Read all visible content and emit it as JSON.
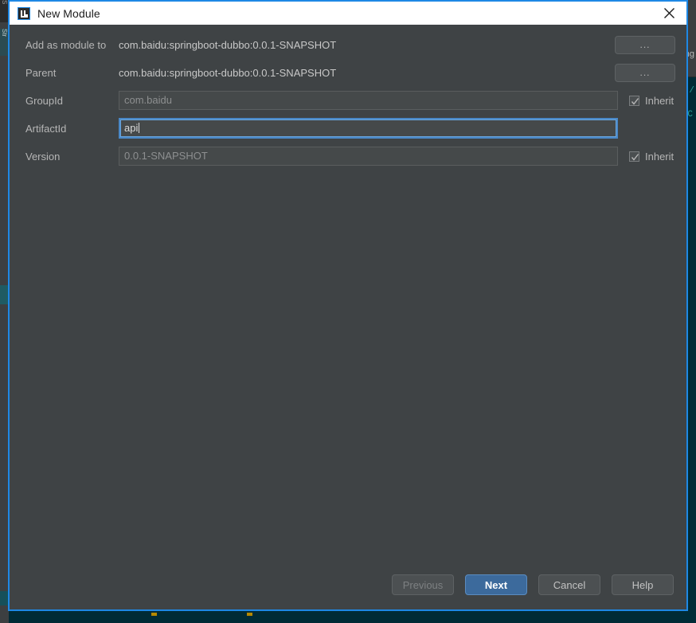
{
  "background": {
    "left_strip_tabs": [
      "S",
      "Str"
    ],
    "right_tab_label": "ng",
    "code_fragments": [
      "/",
      "C"
    ]
  },
  "dialog": {
    "title": "New Module",
    "app_icon": "intellij-idea-icon",
    "close_icon": "close-icon",
    "fields": [
      {
        "label": "Add as module to",
        "kind": "static",
        "value": "com.baidu:springboot-dubbo:0.0.1-SNAPSHOT",
        "browse_label": "...",
        "has_browse": true,
        "has_inherit": false
      },
      {
        "label": "Parent",
        "kind": "static",
        "value": "com.baidu:springboot-dubbo:0.0.1-SNAPSHOT",
        "browse_label": "...",
        "has_browse": true,
        "has_inherit": false
      },
      {
        "label": "GroupId",
        "kind": "input",
        "value": "com.baidu",
        "focused": false,
        "has_browse": false,
        "has_inherit": true,
        "inherit_label": "Inherit",
        "inherit_checked": true
      },
      {
        "label": "ArtifactId",
        "kind": "input",
        "value": "api",
        "focused": true,
        "has_browse": false,
        "has_inherit": false
      },
      {
        "label": "Version",
        "kind": "input",
        "value": "0.0.1-SNAPSHOT",
        "focused": false,
        "has_browse": false,
        "has_inherit": true,
        "inherit_label": "Inherit",
        "inherit_checked": true
      }
    ],
    "buttons": [
      {
        "label": "Previous",
        "style": "disabled"
      },
      {
        "label": "Next",
        "style": "default"
      },
      {
        "label": "Cancel",
        "style": "normal"
      },
      {
        "label": "Help",
        "style": "normal"
      }
    ]
  },
  "colors": {
    "dialog_border": "#1e88e5",
    "dialog_bg": "#3f4345",
    "titlebar_bg": "#ffffff",
    "focus_border": "#4a88c7",
    "default_button_bg": "#3c6a9c",
    "label_text": "#b6b6b6",
    "ide_editor_bg": "#002b36"
  }
}
